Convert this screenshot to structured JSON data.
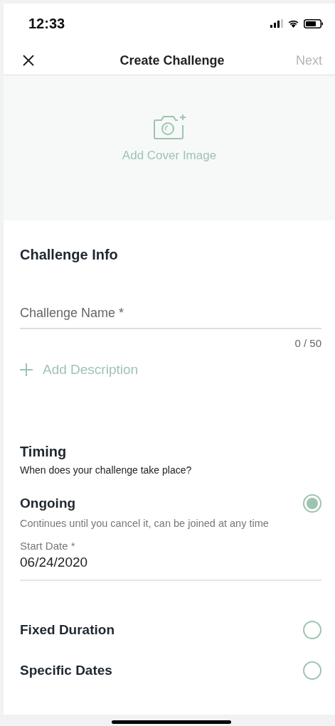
{
  "status_bar": {
    "time": "12:33"
  },
  "nav": {
    "title": "Create Challenge",
    "next": {
      "label": "Next",
      "disabled": true
    }
  },
  "cover": {
    "label": "Add Cover Image"
  },
  "challenge_info": {
    "title": "Challenge Info",
    "name_field": {
      "placeholder": "Challenge Name *"
    },
    "counter": "0 / 50",
    "add_description": "Add Description"
  },
  "timing": {
    "title": "Timing",
    "subtitle": "When does your challenge take place?",
    "options": [
      {
        "label": "Ongoing",
        "selected": true,
        "description": "Continues until you cancel it, can be joined at any time",
        "start_date": {
          "label": "Start Date *",
          "value": "06/24/2020"
        }
      },
      {
        "label": "Fixed Duration",
        "selected": false
      },
      {
        "label": "Specific Dates",
        "selected": false
      }
    ]
  }
}
